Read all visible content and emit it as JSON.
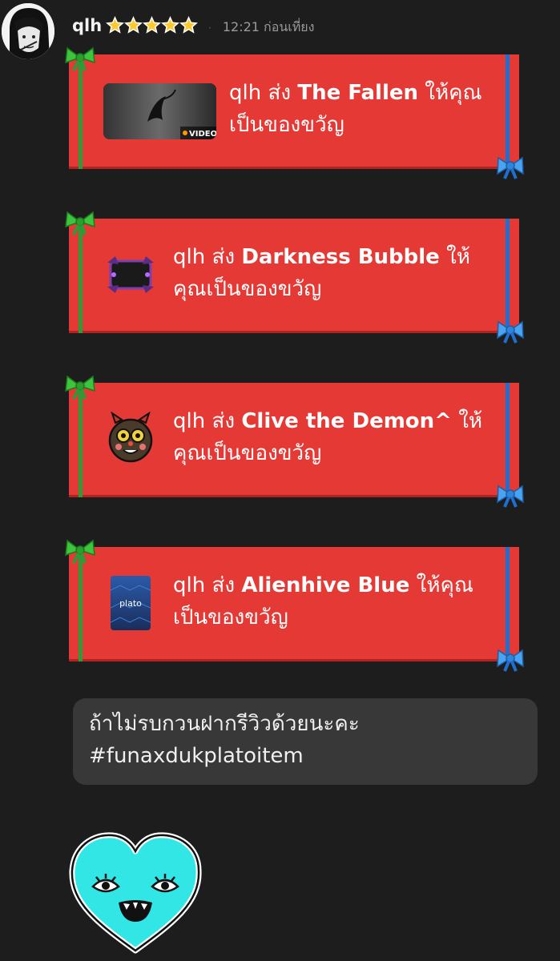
{
  "header": {
    "username": "qlh",
    "stars": 5,
    "time": "12:21 ก่อนเที่ยง"
  },
  "gifts": [
    {
      "sender": "qlh",
      "verb": "ส่ง",
      "item": "The Fallen",
      "rest": "ให้คุณ",
      "line2": "เป็นของขวัญ",
      "thumb_type": "video",
      "thumb_label": "VIDEO"
    },
    {
      "sender": "qlh",
      "verb": "ส่ง",
      "item": "Darkness Bubble",
      "rest": "ให้",
      "line2": "คุณเป็นของขวัญ",
      "thumb_type": "bubble"
    },
    {
      "sender": "qlh",
      "verb": "ส่ง",
      "item": "Clive the Demon^",
      "rest": "ให้",
      "line2": "คุณเป็นของขวัญ",
      "thumb_type": "demon"
    },
    {
      "sender": "qlh",
      "verb": "ส่ง",
      "item": "Alienhive Blue",
      "rest": "ให้คุณ",
      "line2": "เป็นของขวัญ",
      "thumb_type": "plato",
      "thumb_label": "plato"
    }
  ],
  "message": {
    "line1": "ถ้าไม่รบกวนฝากรีวิวด้วยนะคะ",
    "line2": "#funaxdukplatoitem"
  },
  "colors": {
    "background": "#1d1d1d",
    "gift_red": "#e53935",
    "ribbon_green": "#2e9b37",
    "ribbon_blue": "#1f6fd1",
    "bubble": "#383838",
    "sticker_cyan": "#33e6e6"
  }
}
